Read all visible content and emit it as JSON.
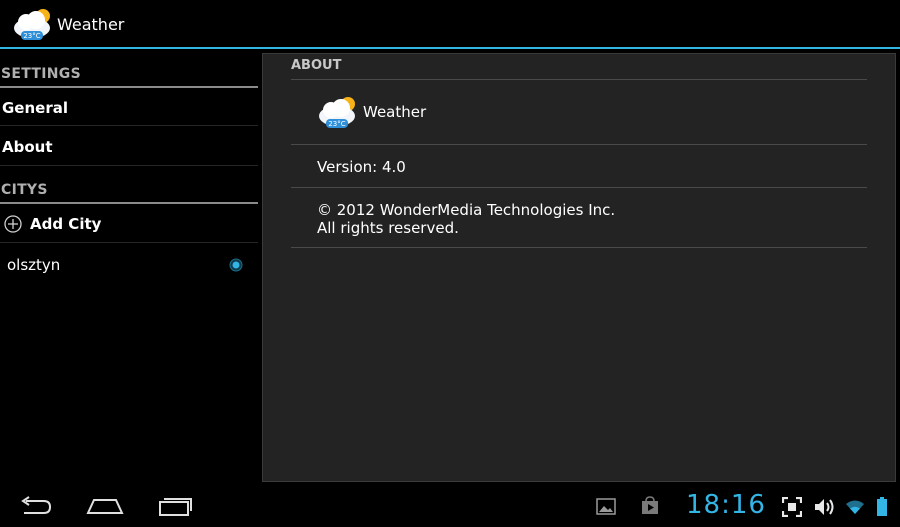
{
  "app": {
    "title": "Weather",
    "icon_temp": "23°C"
  },
  "sidebar": {
    "settings_header": "SETTINGS",
    "items": [
      {
        "label": "General"
      },
      {
        "label": "About"
      }
    ],
    "citys_header": "CITYS",
    "add_city_label": "Add City",
    "cities": [
      {
        "name": "olsztyn",
        "selected": true
      }
    ]
  },
  "about": {
    "header": "ABOUT",
    "app_name": "Weather",
    "icon_temp": "23°C",
    "version": "Version: 4.0",
    "copyright_line1": "© 2012 WonderMedia Technologies Inc.",
    "copyright_line2": "All rights reserved."
  },
  "status_bar": {
    "time": "18:16"
  },
  "colors": {
    "accent": "#33b5e5",
    "pane_bg": "#232323"
  }
}
